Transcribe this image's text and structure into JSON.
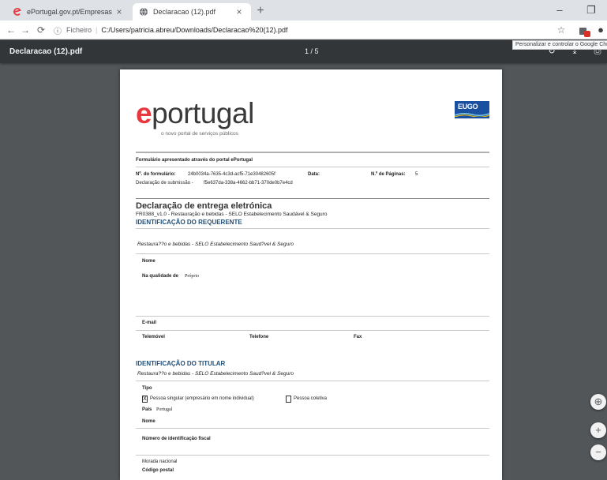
{
  "browser": {
    "tabs": [
      {
        "title": "ePortugal.gov.pt/Empresas",
        "close": "×",
        "active": false
      },
      {
        "title": "Declaracao (12).pdf",
        "close": "×",
        "active": true
      }
    ],
    "new_tab": "+",
    "window_controls": {
      "minimize": "–",
      "restore": "❐"
    },
    "nav": {
      "back": "←",
      "forward": "→",
      "reload": "⟳"
    },
    "omnibox": {
      "info_icon": "ⓘ",
      "scheme": "Ficheiro",
      "separator": "|",
      "url": "C:/Users/patricia.abreu/Downloads/Declaracao%20(12).pdf"
    },
    "bookmark_star": "☆",
    "profile_icon": "●",
    "tooltip": "Personalizar e controlar o Google Chrome",
    "accent": "#d93025"
  },
  "pdf_toolbar": {
    "filename": "Declaracao (12).pdf",
    "page_indicator": "1 / 5",
    "rotate_icon": "↻",
    "download_icon": "⤓",
    "print_icon": "⎙"
  },
  "document": {
    "logo_e": "e",
    "logo_rest": "portugal",
    "logo_tagline": "o novo portal de serviços públicos",
    "eugo_label": "EUGO",
    "form_source": "Formulário apresentado através do portal ePortugal",
    "form_number_label": "Nº. do formulário:",
    "form_number_value": "24b0034a-7635-4c3d-acf5-71e30482605f",
    "date_label": "Data:",
    "pages_label": "N.º de Páginas:",
    "pages_value": "5",
    "submission_label": "Declaração de submissão -",
    "submission_value": "f5e637da-338a-4662-bb71-370de0b7e4cd",
    "title": "Declaração de entrega eletrónica",
    "subtitle": "FR0388_v1.0 - Restauração e bebidas - SELO Estabelecimento Saudável & Seguro",
    "section1_heading": "IDENTIFICAÇÃO DO REQUERENTE",
    "section1_service": "Restaura??o e bebidas - SELO Estabelecimento Saud?vel & Seguro",
    "name_label": "Nome",
    "quality_label": "Na qualidade de",
    "quality_value": "Próprio",
    "email_label": "E-mail",
    "mobile_label": "Telemóvel",
    "phone_label": "Telefone",
    "fax_label": "Fax",
    "section2_heading": "IDENTIFICAÇÃO DO TITULAR",
    "section2_service": "Restaura??o e bebidas - SELO Estabelecimento Saud?vel & Seguro",
    "type_label": "Tipo",
    "type_option1_mark": "X",
    "type_option1": "Pessoa singular (empresário em nome individual)",
    "type_option2": "Pessoa coletiva",
    "country_label": "País",
    "country_value": "Portugal",
    "holder_name_label": "Nome",
    "nif_label": "Número de identificação fiscal",
    "address_label": "Morada nacional",
    "postal_label": "Código postal"
  },
  "zoom": {
    "fit": "⊕",
    "in": "+",
    "out": "−"
  }
}
